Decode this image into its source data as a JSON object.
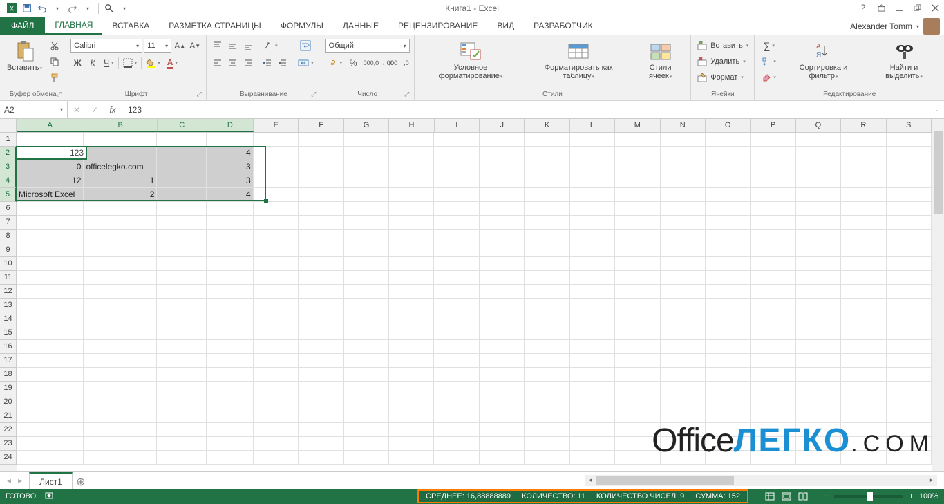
{
  "title": "Книга1 - Excel",
  "user": "Alexander Tomm",
  "tabs": {
    "file": "ФАЙЛ",
    "items": [
      "ГЛАВНАЯ",
      "ВСТАВКА",
      "РАЗМЕТКА СТРАНИЦЫ",
      "ФОРМУЛЫ",
      "ДАННЫЕ",
      "РЕЦЕНЗИРОВАНИЕ",
      "ВИД",
      "РАЗРАБОТЧИК"
    ],
    "active": 0
  },
  "ribbon": {
    "clipboard": {
      "paste": "Вставить",
      "label": "Буфер обмена"
    },
    "font": {
      "name": "Calibri",
      "size": "11",
      "label": "Шрифт",
      "bold": "Ж",
      "italic": "К",
      "underline": "Ч"
    },
    "align": {
      "label": "Выравнивание"
    },
    "number": {
      "format": "Общий",
      "label": "Число"
    },
    "styles": {
      "cond": "Условное форматирование",
      "table": "Форматировать как таблицу",
      "cell": "Стили ячеек",
      "label": "Стили"
    },
    "cells": {
      "insert": "Вставить",
      "delete": "Удалить",
      "format": "Формат",
      "label": "Ячейки"
    },
    "editing": {
      "sort": "Сортировка и фильтр",
      "find": "Найти и выделить",
      "label": "Редактирование"
    }
  },
  "formula": {
    "name": "A2",
    "value": "123",
    "fx": "fx"
  },
  "grid": {
    "columns": [
      "A",
      "B",
      "C",
      "D",
      "E",
      "F",
      "G",
      "H",
      "I",
      "J",
      "K",
      "L",
      "M",
      "N",
      "O",
      "P",
      "Q",
      "R",
      "S"
    ],
    "colWidth": {
      "default": 69,
      "A": 103,
      "B": 112,
      "C": 76,
      "D": 71
    },
    "rows": 24,
    "selRows": [
      2,
      3,
      4,
      5
    ],
    "selCols": [
      "A",
      "B",
      "C",
      "D"
    ],
    "data": {
      "2": {
        "A": "123",
        "D": "4"
      },
      "3": {
        "A": "0",
        "B": "officelegko.com",
        "D": "3"
      },
      "4": {
        "A": "12",
        "B": "1",
        "D": "3"
      },
      "5": {
        "A": "Microsoft Excel",
        "B": "2",
        "D": "4"
      }
    },
    "numeric": {
      "2A": true,
      "2D": true,
      "3A": true,
      "3D": true,
      "4A": true,
      "4B": true,
      "4D": true,
      "5B": true,
      "5D": true
    }
  },
  "sheet": {
    "name": "Лист1"
  },
  "status": {
    "ready": "ГОТОВО",
    "avg": "СРЕДНЕЕ: 16,88888889",
    "count": "КОЛИЧЕСТВО: 11",
    "numcount": "КОЛИЧЕСТВО ЧИСЕЛ: 9",
    "sum": "СУММА: 152",
    "zoom": "100%"
  },
  "watermark": {
    "a": "Office",
    "b": "ЛЕГКО",
    "c": ".COM"
  }
}
